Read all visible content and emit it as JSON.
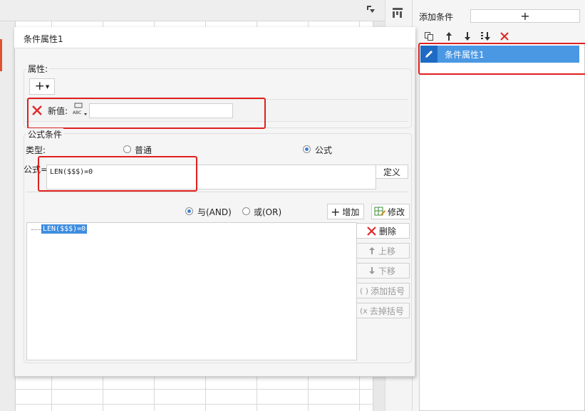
{
  "window": {
    "dialog_title": "条件属性1"
  },
  "right_panel": {
    "add_condition_label": "添加条件",
    "add_button_glyph": "+",
    "toolbar_icons": [
      "copy-icon",
      "arrow-up-icon",
      "arrow-down-icon",
      "move-bottom-icon",
      "delete-icon"
    ],
    "list_items": [
      {
        "label": "条件属性1",
        "icon": "pencil-icon",
        "selected": true
      }
    ]
  },
  "dialog": {
    "attributes_section": {
      "title": "属性:",
      "add_glyph": "+",
      "new_value_label": "新值:",
      "new_value": "",
      "type_icon_text": "ABC"
    },
    "formula_section": {
      "title": "公式条件",
      "type_label": "类型:",
      "type_options": [
        {
          "label": "普通",
          "checked": false
        },
        {
          "label": "公式",
          "checked": true
        }
      ],
      "formula_label": "公式=",
      "formula_value": "LEN($$$)=0",
      "define_button": "定义",
      "logic_options": [
        {
          "label": "与(AND)",
          "checked": true
        },
        {
          "label": "或(OR)",
          "checked": false
        }
      ],
      "add_button": "增加",
      "modify_button": "修改",
      "condition_tree": [
        "LEN($$$)=0"
      ],
      "side_buttons": {
        "delete": "删除",
        "move_up": "上移",
        "move_down": "下移",
        "add_bracket": "添加括号",
        "remove_bracket": "去掉括号"
      }
    }
  },
  "colors": {
    "highlight": "#e0201f",
    "selection": "#4a98e4",
    "tree_selection": "#3e8de0"
  }
}
